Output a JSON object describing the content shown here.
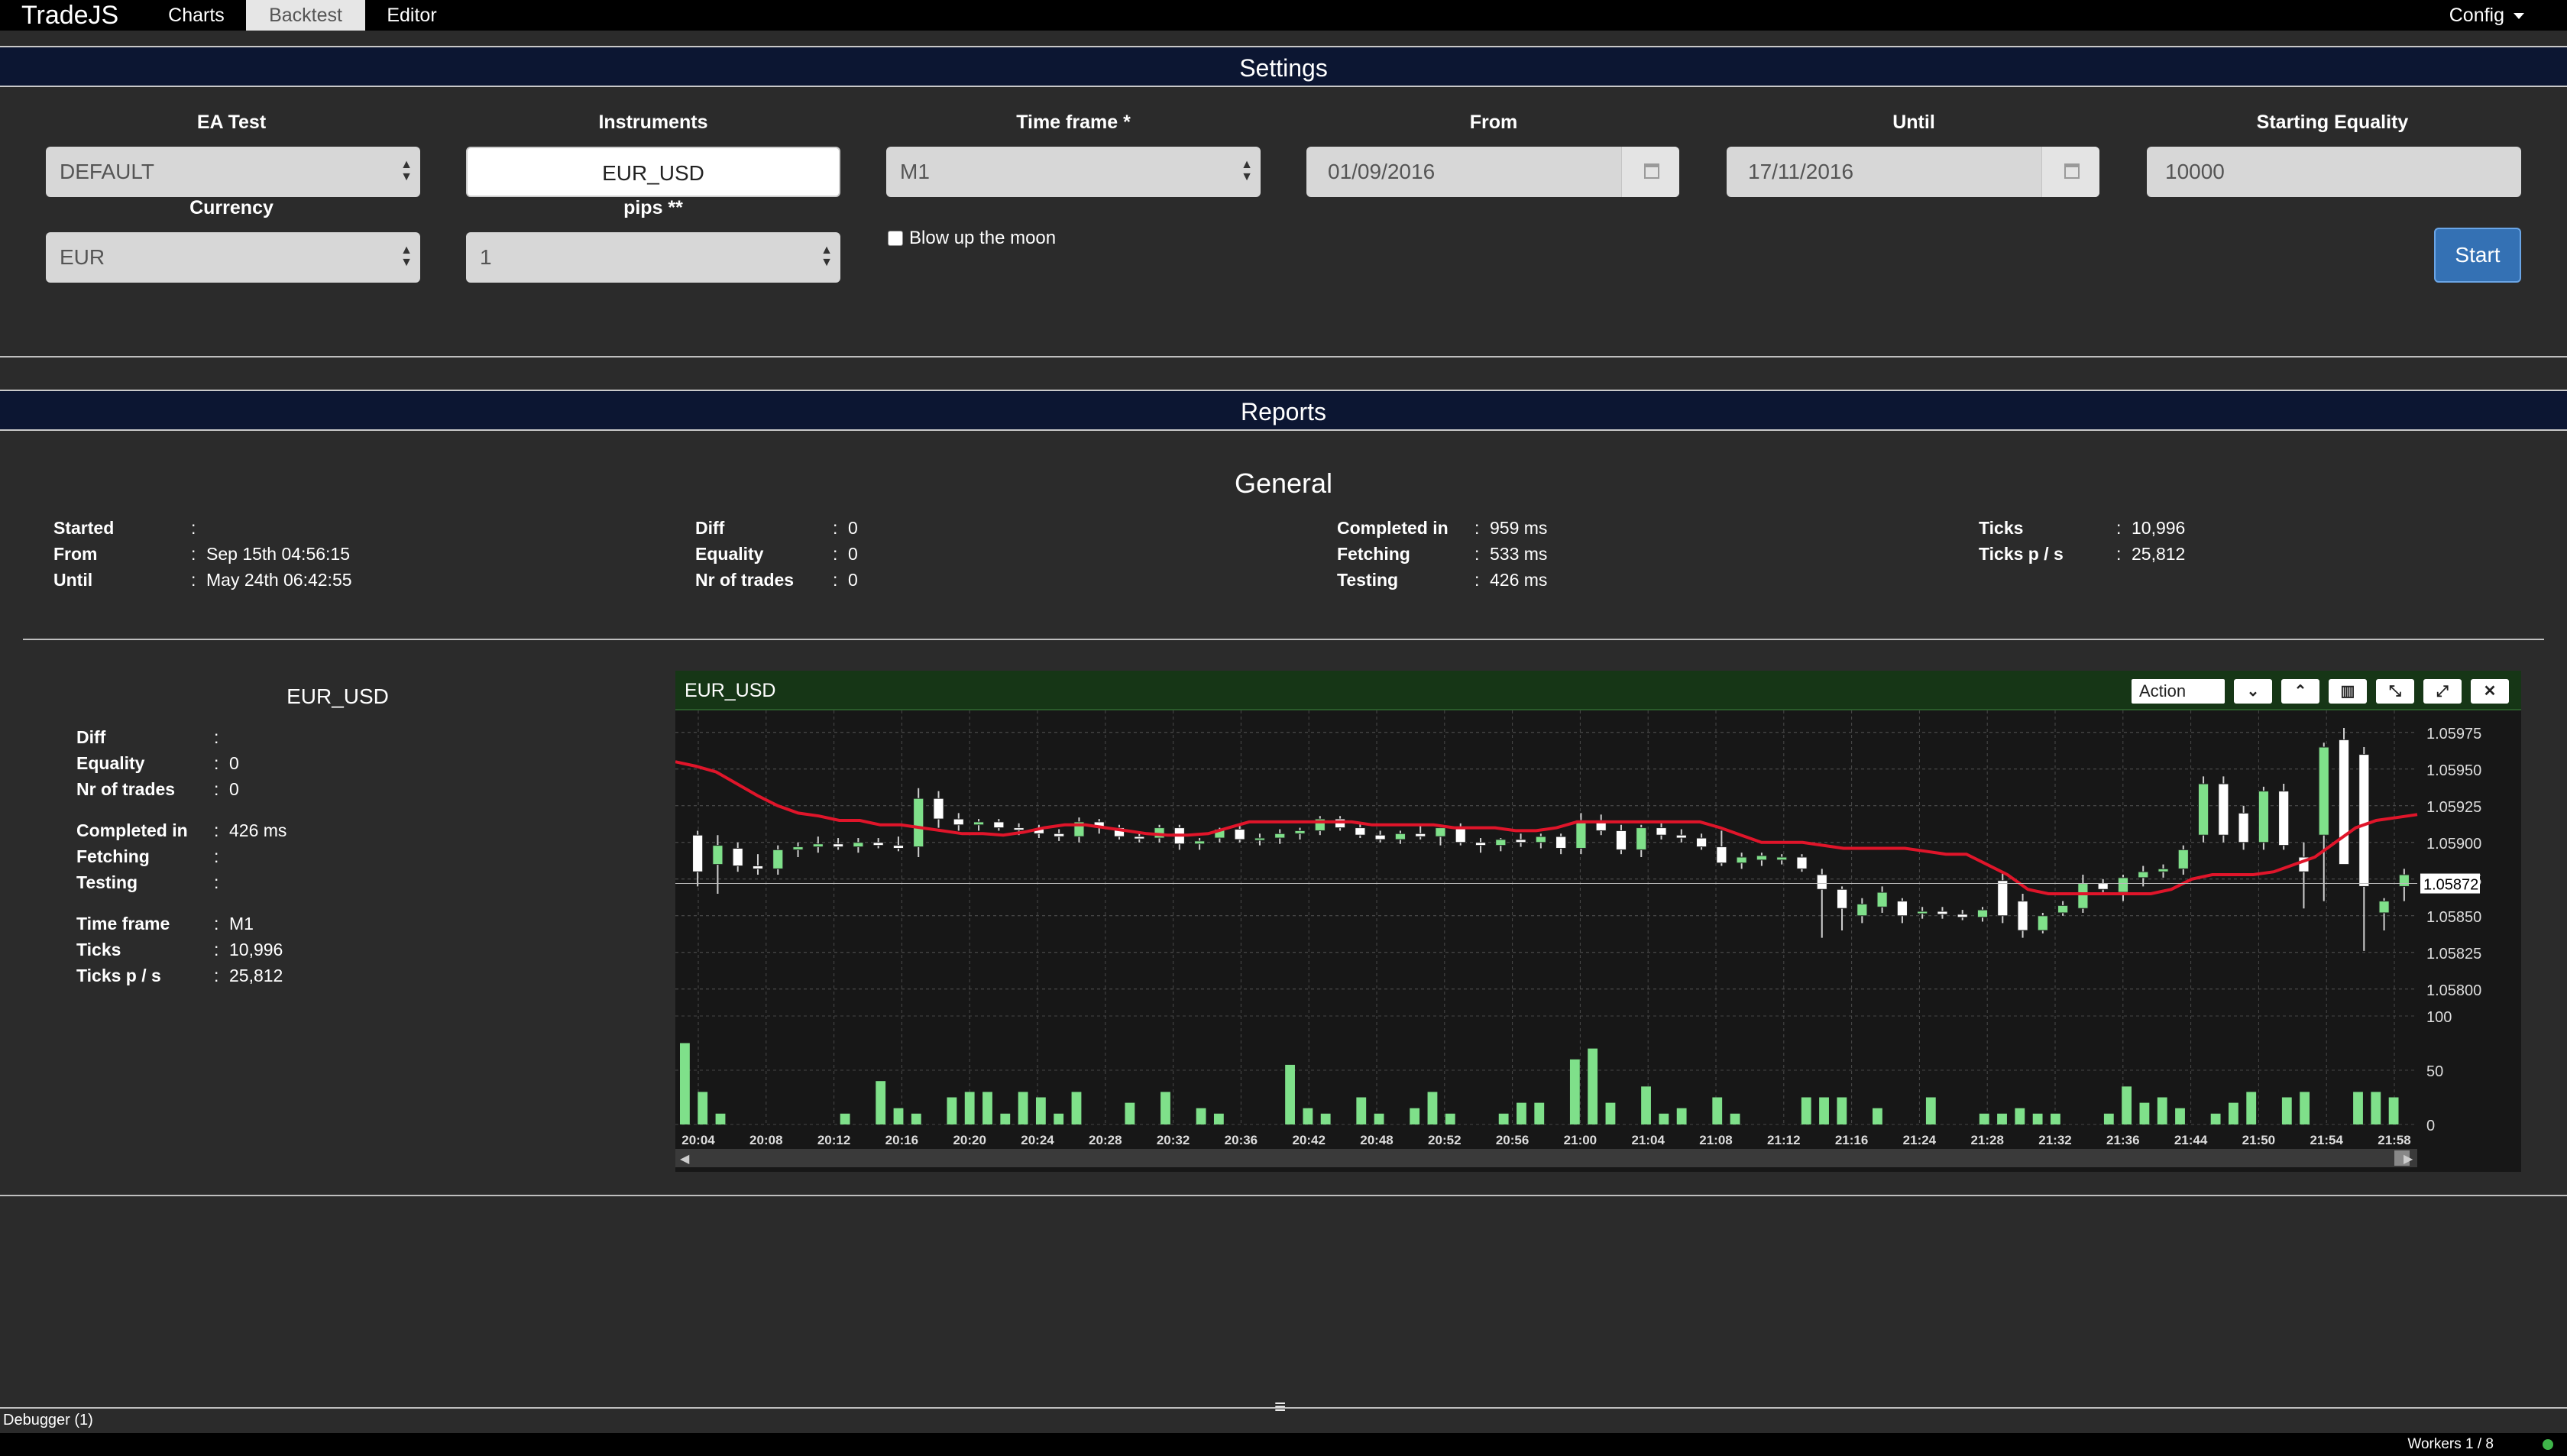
{
  "navbar": {
    "brand": "TradeJS",
    "tabs": [
      {
        "label": "Charts"
      },
      {
        "label": "Backtest"
      },
      {
        "label": "Editor"
      }
    ],
    "active_tab": "Backtest",
    "config_label": "Config"
  },
  "settings": {
    "title": "Settings",
    "ea_test": {
      "label": "EA Test",
      "value": "DEFAULT"
    },
    "instruments": {
      "label": "Instruments",
      "value": "EUR_USD"
    },
    "time_frame": {
      "label": "Time frame *",
      "value": "M1"
    },
    "from": {
      "label": "From",
      "value": "01/09/2016"
    },
    "until": {
      "label": "Until",
      "value": "17/11/2016"
    },
    "starting_equality": {
      "label": "Starting Equality",
      "value": "10000"
    },
    "currency": {
      "label": "Currency",
      "value": "EUR"
    },
    "pips": {
      "label": "pips **",
      "value": "1"
    },
    "blow_up_label": "Blow up the moon",
    "blow_up_checked": false,
    "start_label": "Start"
  },
  "reports": {
    "title": "Reports",
    "general_title": "General",
    "general": [
      [
        {
          "key": "Started",
          "value": ""
        },
        {
          "key": "From",
          "value": "Sep 15th 04:56:15"
        },
        {
          "key": "Until",
          "value": "May 24th 06:42:55"
        }
      ],
      [
        {
          "key": "Diff",
          "value": "0"
        },
        {
          "key": "Equality",
          "value": "0"
        },
        {
          "key": "Nr of trades",
          "value": "0"
        }
      ],
      [
        {
          "key": "Completed in",
          "value": "959 ms"
        },
        {
          "key": "Fetching",
          "value": "533 ms"
        },
        {
          "key": "Testing",
          "value": "426 ms"
        }
      ],
      [
        {
          "key": "Ticks",
          "value": "10,996"
        },
        {
          "key": "Ticks p / s",
          "value": "25,812"
        }
      ]
    ],
    "instrument": {
      "title": "EUR_USD",
      "groups": [
        [
          {
            "key": "Diff",
            "value": ""
          },
          {
            "key": "Equality",
            "value": "0"
          },
          {
            "key": "Nr of trades",
            "value": "0"
          }
        ],
        [
          {
            "key": "Completed in",
            "value": "426 ms"
          },
          {
            "key": "Fetching",
            "value": ""
          },
          {
            "key": "Testing",
            "value": ""
          }
        ],
        [
          {
            "key": "Time frame",
            "value": "M1"
          },
          {
            "key": "Ticks",
            "value": "10,996"
          },
          {
            "key": "Ticks p / s",
            "value": "25,812"
          }
        ]
      ]
    }
  },
  "chart_widget": {
    "title": "EUR_USD",
    "action_label": "Action",
    "toolbar_icons": [
      "chevron-down-icon",
      "chevron-up-icon",
      "bar-chart-icon",
      "compress-icon",
      "expand-icon",
      "close-icon"
    ]
  },
  "chart_data": {
    "type": "candlestick",
    "title": "EUR_USD",
    "price_axis": {
      "ticks": [
        "1.05975",
        "1.05950",
        "1.05925",
        "1.05900",
        "1.05875",
        "1.05850",
        "1.05825",
        "1.05800"
      ],
      "ylim": [
        1.0579,
        1.0599
      ]
    },
    "current_price_label": "1.05872",
    "volume_axis": {
      "ticks": [
        "100",
        "50",
        "0"
      ],
      "ylim": [
        0,
        100
      ]
    },
    "x_labels": [
      "20:04",
      "20:08",
      "20:12",
      "20:16",
      "20:20",
      "20:24",
      "20:28",
      "20:32",
      "20:36",
      "20:42",
      "20:48",
      "20:52",
      "20:56",
      "21:00",
      "21:04",
      "21:08",
      "21:12",
      "21:16",
      "21:24",
      "21:28",
      "21:32",
      "21:36",
      "21:44",
      "21:50",
      "21:54",
      "21:58"
    ],
    "ohlc": [
      [
        1.05905,
        1.05908,
        1.0587,
        1.0588
      ],
      [
        1.05885,
        1.05905,
        1.05865,
        1.05898
      ],
      [
        1.05896,
        1.059,
        1.0588,
        1.05884
      ],
      [
        1.05884,
        1.05892,
        1.05878,
        1.05882
      ],
      [
        1.05882,
        1.05898,
        1.05878,
        1.05895
      ],
      [
        1.05895,
        1.059,
        1.0589,
        1.05897
      ],
      [
        1.05897,
        1.05904,
        1.05893,
        1.05899
      ],
      [
        1.05899,
        1.05903,
        1.05895,
        1.05897
      ],
      [
        1.05897,
        1.05903,
        1.05893,
        1.059
      ],
      [
        1.059,
        1.05903,
        1.05896,
        1.05898
      ],
      [
        1.05898,
        1.05904,
        1.05894,
        1.05896
      ],
      [
        1.05897,
        1.05937,
        1.0589,
        1.0593
      ],
      [
        1.0593,
        1.05935,
        1.0591,
        1.05916
      ],
      [
        1.05916,
        1.0592,
        1.05908,
        1.05912
      ],
      [
        1.05912,
        1.05916,
        1.05908,
        1.05914
      ],
      [
        1.05914,
        1.05916,
        1.05908,
        1.0591
      ],
      [
        1.0591,
        1.05913,
        1.05905,
        1.05909
      ],
      [
        1.05909,
        1.05912,
        1.05903,
        1.05906
      ],
      [
        1.05906,
        1.05909,
        1.05901,
        1.05904
      ],
      [
        1.05904,
        1.05917,
        1.059,
        1.05914
      ],
      [
        1.05914,
        1.05916,
        1.05906,
        1.0591
      ],
      [
        1.0591,
        1.05912,
        1.05902,
        1.05904
      ],
      [
        1.05904,
        1.05906,
        1.059,
        1.05903
      ],
      [
        1.05903,
        1.05912,
        1.059,
        1.0591
      ],
      [
        1.0591,
        1.05912,
        1.05895,
        1.05899
      ],
      [
        1.05899,
        1.05903,
        1.05895,
        1.05901
      ],
      [
        1.05903,
        1.0591,
        1.059,
        1.05909
      ],
      [
        1.05909,
        1.05912,
        1.059,
        1.05902
      ],
      [
        1.05902,
        1.05906,
        1.05898,
        1.05903
      ],
      [
        1.05903,
        1.05909,
        1.05899,
        1.05906
      ],
      [
        1.05906,
        1.0591,
        1.05902,
        1.05908
      ],
      [
        1.05908,
        1.05918,
        1.05905,
        1.05916
      ],
      [
        1.05916,
        1.05918,
        1.05908,
        1.0591
      ],
      [
        1.0591,
        1.05913,
        1.05903,
        1.05905
      ],
      [
        1.05905,
        1.05908,
        1.059,
        1.05902
      ],
      [
        1.05902,
        1.05908,
        1.05899,
        1.05906
      ],
      [
        1.05906,
        1.05912,
        1.05902,
        1.05904
      ],
      [
        1.05904,
        1.05912,
        1.05898,
        1.0591
      ],
      [
        1.0591,
        1.05913,
        1.05898,
        1.059
      ],
      [
        1.059,
        1.05903,
        1.05893,
        1.05898
      ],
      [
        1.05898,
        1.05903,
        1.05894,
        1.05902
      ],
      [
        1.05902,
        1.05906,
        1.05897,
        1.059
      ],
      [
        1.059,
        1.05906,
        1.05896,
        1.05904
      ],
      [
        1.05904,
        1.05906,
        1.05892,
        1.05896
      ],
      [
        1.05896,
        1.0592,
        1.05892,
        1.05915
      ],
      [
        1.05915,
        1.05919,
        1.05905,
        1.05908
      ],
      [
        1.05908,
        1.05912,
        1.05892,
        1.05895
      ],
      [
        1.05895,
        1.05912,
        1.0589,
        1.0591
      ],
      [
        1.0591,
        1.05913,
        1.05902,
        1.05905
      ],
      [
        1.05905,
        1.05909,
        1.059,
        1.05903
      ],
      [
        1.05903,
        1.05906,
        1.05895,
        1.05897
      ],
      [
        1.05897,
        1.05908,
        1.05884,
        1.05886
      ],
      [
        1.05886,
        1.05893,
        1.05882,
        1.0589
      ],
      [
        1.05888,
        1.05893,
        1.05884,
        1.05891
      ],
      [
        1.05888,
        1.05892,
        1.05885,
        1.0589
      ],
      [
        1.0589,
        1.05892,
        1.0588,
        1.05882
      ],
      [
        1.05878,
        1.05882,
        1.05835,
        1.05868
      ],
      [
        1.05868,
        1.0587,
        1.0584,
        1.05855
      ],
      [
        1.0585,
        1.05862,
        1.05845,
        1.05858
      ],
      [
        1.05856,
        1.0587,
        1.05852,
        1.05866
      ],
      [
        1.0586,
        1.05862,
        1.05845,
        1.0585
      ],
      [
        1.05852,
        1.05856,
        1.05848,
        1.05853
      ],
      [
        1.05853,
        1.05856,
        1.05848,
        1.05851
      ],
      [
        1.05851,
        1.05854,
        1.05847,
        1.05849
      ],
      [
        1.05849,
        1.05856,
        1.05846,
        1.05854
      ],
      [
        1.05874,
        1.0588,
        1.05845,
        1.0585
      ],
      [
        1.0586,
        1.05865,
        1.05835,
        1.0584
      ],
      [
        1.0584,
        1.05852,
        1.05838,
        1.0585
      ],
      [
        1.05852,
        1.0586,
        1.0585,
        1.05857
      ],
      [
        1.05855,
        1.05878,
        1.05852,
        1.05872
      ],
      [
        1.05872,
        1.05875,
        1.05865,
        1.05868
      ],
      [
        1.05866,
        1.05878,
        1.0586,
        1.05876
      ],
      [
        1.05876,
        1.05884,
        1.0587,
        1.0588
      ],
      [
        1.0588,
        1.05885,
        1.05876,
        1.05882
      ],
      [
        1.05882,
        1.05898,
        1.05878,
        1.05895
      ],
      [
        1.05905,
        1.05945,
        1.059,
        1.0594
      ],
      [
        1.0594,
        1.05945,
        1.059,
        1.05905
      ],
      [
        1.0592,
        1.05925,
        1.05895,
        1.059
      ],
      [
        1.059,
        1.05938,
        1.05895,
        1.05935
      ],
      [
        1.05935,
        1.0594,
        1.05895,
        1.05898
      ],
      [
        1.0589,
        1.059,
        1.05855,
        1.0588
      ],
      [
        1.05905,
        1.05968,
        1.0586,
        1.05965
      ],
      [
        1.0597,
        1.05978,
        1.05885,
        1.05885
      ],
      [
        1.0596,
        1.05965,
        1.05826,
        1.0587
      ],
      [
        1.05852,
        1.05862,
        1.0584,
        1.0586
      ],
      [
        1.0587,
        1.05882,
        1.0586,
        1.05878
      ]
    ],
    "moving_average": [
      1.05955,
      1.05952,
      1.05948,
      1.0594,
      1.05932,
      1.05925,
      1.0592,
      1.05918,
      1.05915,
      1.05915,
      1.05912,
      1.05912,
      1.0591,
      1.05908,
      1.05906,
      1.05906,
      1.05905,
      1.05907,
      1.0591,
      1.05912,
      1.05912,
      1.0591,
      1.05908,
      1.05906,
      1.05905,
      1.05905,
      1.05906,
      1.0591,
      1.05914,
      1.05914,
      1.05914,
      1.05914,
      1.05914,
      1.05914,
      1.05912,
      1.05912,
      1.05912,
      1.05912,
      1.0591,
      1.0591,
      1.0591,
      1.05908,
      1.05908,
      1.0591,
      1.05914,
      1.05914,
      1.05914,
      1.05914,
      1.05914,
      1.05914,
      1.05914,
      1.0591,
      1.05905,
      1.059,
      1.059,
      1.059,
      1.05898,
      1.05896,
      1.05896,
      1.05896,
      1.05896,
      1.05894,
      1.05892,
      1.05892,
      1.05885,
      1.05878,
      1.05868,
      1.05865,
      1.05865,
      1.05865,
      1.05865,
      1.05865,
      1.05865,
      1.05868,
      1.05875,
      1.05878,
      1.05878,
      1.05878,
      1.0588,
      1.05885,
      1.0589,
      1.059,
      1.0591,
      1.05915,
      1.05917,
      1.05919
    ],
    "volumes": [
      75,
      30,
      10,
      0,
      0,
      0,
      0,
      0,
      0,
      10,
      0,
      40,
      15,
      10,
      0,
      25,
      30,
      30,
      10,
      30,
      25,
      10,
      30,
      0,
      0,
      20,
      0,
      30,
      0,
      15,
      10,
      0,
      0,
      0,
      55,
      15,
      10,
      0,
      25,
      10,
      0,
      15,
      30,
      10,
      0,
      0,
      10,
      20,
      20,
      0,
      60,
      70,
      20,
      0,
      35,
      10,
      15,
      0,
      25,
      10,
      0,
      0,
      0,
      25,
      25,
      25,
      0,
      15,
      0,
      0,
      25,
      0,
      0,
      10,
      10,
      15,
      10,
      10,
      0,
      0,
      10,
      35,
      20,
      25,
      15,
      0,
      10,
      20,
      30,
      0,
      25,
      30,
      0,
      0,
      30,
      30,
      25
    ]
  }
}
